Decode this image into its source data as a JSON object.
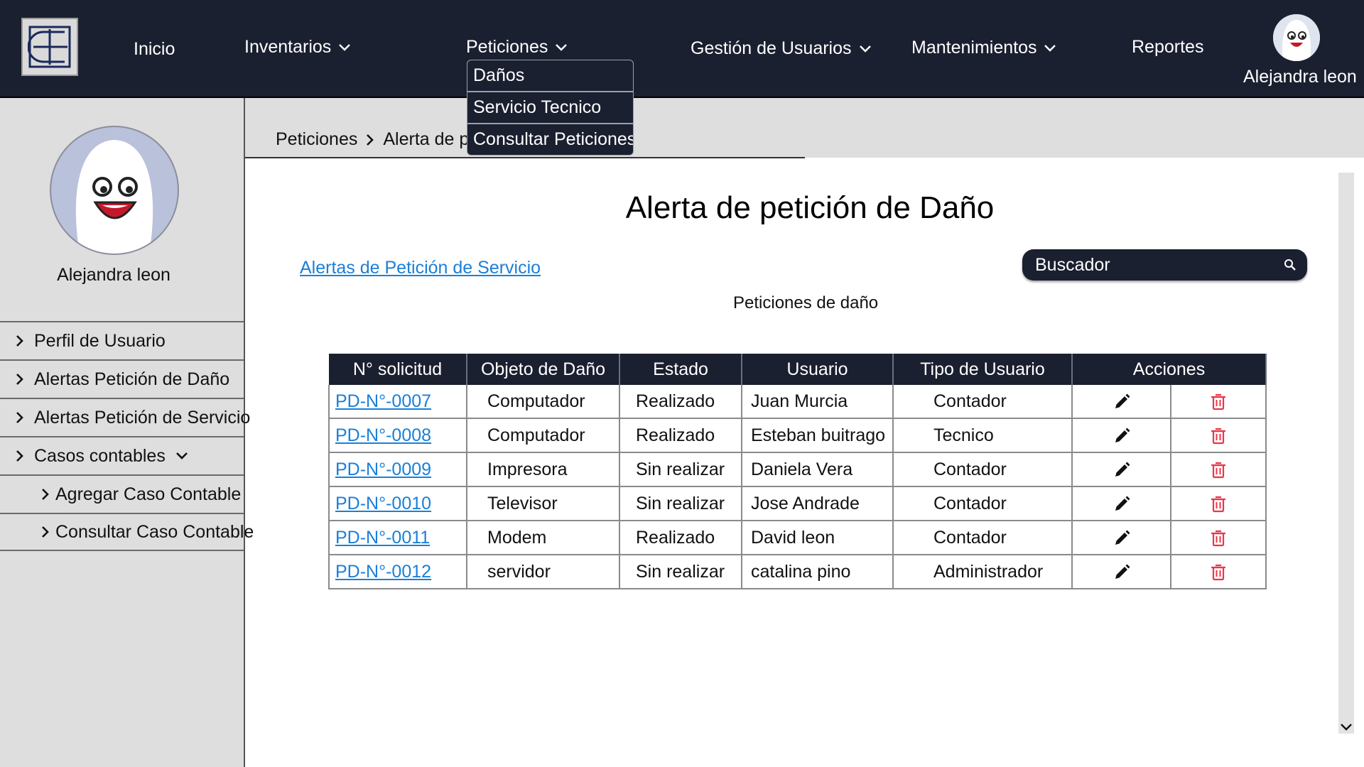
{
  "nav": {
    "items": [
      {
        "key": "inicio",
        "label": "Inicio",
        "has_dropdown": false
      },
      {
        "key": "inventarios",
        "label": "Inventarios",
        "has_dropdown": true
      },
      {
        "key": "peticiones",
        "label": "Peticiones",
        "has_dropdown": true
      },
      {
        "key": "gestion",
        "label": "Gestión de Usuarios",
        "has_dropdown": true
      },
      {
        "key": "mantenimientos",
        "label": "Mantenimientos",
        "has_dropdown": true
      },
      {
        "key": "reportes",
        "label": "Reportes",
        "has_dropdown": false
      }
    ],
    "user_name": "Alejandra leon",
    "peticiones_dropdown": [
      "Daños",
      "Servicio Tecnico",
      "Consultar Peticiones"
    ]
  },
  "sidebar": {
    "user_name": "Alejandra leon",
    "items": [
      {
        "label": "Perfil de Usuario"
      },
      {
        "label": "Alertas Petición de Daño"
      },
      {
        "label": "Alertas Petición de Servicio"
      },
      {
        "label": "Casos contables"
      },
      {
        "label": "Agregar Caso Contable"
      },
      {
        "label": "Consultar Caso Contable"
      }
    ]
  },
  "breadcrumb": [
    "Peticiones",
    "Alerta de pet"
  ],
  "main": {
    "title": "Alerta de petición de Daño",
    "service_link": "Alertas de Petición de Servicio",
    "search_placeholder": "Buscador",
    "table_caption": "Peticiones de daño"
  },
  "table": {
    "headers": [
      "N° solicitud",
      "Objeto de Daño",
      "Estado",
      "Usuario",
      "Tipo de Usuario",
      "Acciones"
    ],
    "rows": [
      {
        "id": "PD-N°-0007",
        "objeto": "Computador",
        "estado": "Realizado",
        "usuario": "Juan Murcia",
        "tipo": "Contador"
      },
      {
        "id": "PD-N°-0008",
        "objeto": "Computador",
        "estado": "Realizado",
        "usuario": "Esteban buitrago",
        "tipo": "Tecnico"
      },
      {
        "id": "PD-N°-0009",
        "objeto": "Impresora",
        "estado": "Sin realizar",
        "usuario": "Daniela Vera",
        "tipo": "Contador"
      },
      {
        "id": "PD-N°-0010",
        "objeto": "Televisor",
        "estado": "Sin realizar",
        "usuario": "Jose Andrade",
        "tipo": "Contador"
      },
      {
        "id": "PD-N°-0011",
        "objeto": "Modem",
        "estado": "Realizado",
        "usuario": "David leon",
        "tipo": "Contador"
      },
      {
        "id": "PD-N°-0012",
        "objeto": "servidor",
        "estado": "Sin realizar",
        "usuario": "catalina pino",
        "tipo": "Administrador"
      }
    ]
  },
  "icons": {
    "edit": "pencil-icon",
    "delete": "trash-icon",
    "search": "search-icon",
    "chevrons": "chevron-icon"
  },
  "colors": {
    "navbar": "#1b2030",
    "sidebar": "#dedede",
    "link": "#1a7fd9",
    "delete": "#e8374a"
  }
}
